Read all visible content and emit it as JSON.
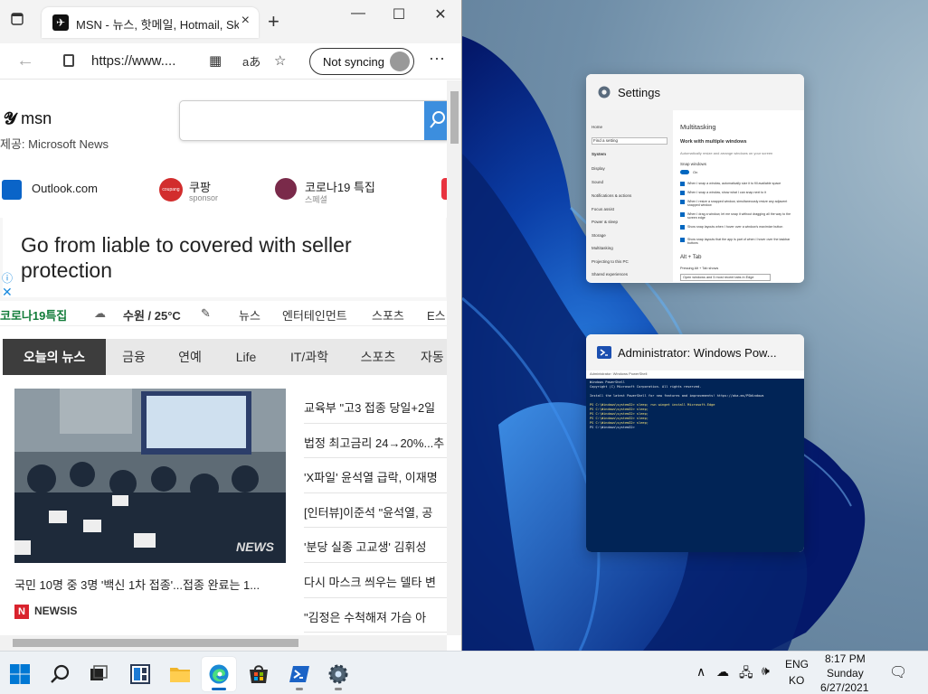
{
  "browser": {
    "tab_title": "MSN - 뉴스, 핫메일, Hotmail, Skype",
    "url": "https://www....",
    "sync_label": "Not syncing",
    "new_tab_symbol": "+",
    "read_aloud_label": "aあ"
  },
  "msn": {
    "logo_text": "msn",
    "provider": "제공: Microsoft News",
    "quick_links": [
      {
        "label": "Outlook.com",
        "sub": ""
      },
      {
        "label": "쿠팡",
        "sub": "sponsor"
      },
      {
        "label": "코로나19 특집",
        "sub": "스페셜"
      }
    ],
    "coupang_icon_text": "coupang",
    "ad_text": "Go from liable to covered with seller protection",
    "ribbon": {
      "covid": "코로나19특집",
      "weather": "수원 / 25°C",
      "links": [
        "뉴스",
        "엔터테인먼트",
        "스포츠",
        "E스"
      ]
    },
    "nav_tabs": [
      "오늘의 뉴스",
      "금융",
      "연예",
      "Life",
      "IT/과학",
      "스포츠",
      "자동"
    ],
    "lead_caption": "국민 10명 중 3명 '백신 1차 접종'...접종 완료는 1...",
    "lead_source": "NEWSIS",
    "lead_source_initial": "N",
    "headlines": [
      "교육부 \"고3 접종 당일+2일",
      "법정 최고금리 24→20%...추",
      "'X파일' 윤석열 급락, 이재명",
      "[인터뷰]이준석 \"윤석열, 공",
      "'분당 실종 고교생' 김휘성",
      "다시 마스크 씌우는 델타 변",
      "\"김정은 수척해져 가슴 아"
    ]
  },
  "snap_settings": {
    "title": "Settings",
    "side_items": [
      "Home",
      "Find a setting",
      "System",
      "Display",
      "Sound",
      "Notifications & actions",
      "Focus assist",
      "Power & sleep",
      "Storage",
      "Multitasking",
      "Projecting to this PC",
      "Shared experiences"
    ],
    "heading": "Multitasking",
    "subheading": "Work with multiple windows",
    "desc": "Automatically resize and arrange windows on your screen",
    "snap_label": "Snap windows",
    "toggle_on": "On",
    "options": [
      "When I snap a window, automatically size it to fill available space",
      "When I snap a window, show what I can snap next to it",
      "When I resize a snapped window, simultaneously resize any adjacent snapped window",
      "When I drag a window, let me snap it without dragging all the way to the screen edge",
      "Show snap layouts when I hover over a window's maximize button",
      "Show snap layouts that the app is part of when I hover over the taskbar buttons"
    ],
    "alt_tab": "Alt + Tab",
    "alt_tab_desc": "Pressing Alt + Tab shows",
    "alt_tab_value": "Open windows and 5 most recent tabs in Edge"
  },
  "snap_powershell": {
    "title": "Administrator: Windows Pow...",
    "titlebar_text": "Administrator: Windows PowerShell",
    "lines": [
      "Windows PowerShell",
      "Copyright (C) Microsoft Corporation. All rights reserved.",
      "",
      "Install the latest PowerShell for new features and improvements! https://aka.ms/PSWindows",
      "",
      "PS C:\\Windows\\system32> sleep; run winget install Microsoft.Edge",
      "PS C:\\Windows\\system32> sleep; ",
      "PS C:\\Windows\\system32> sleep; ",
      "PS C:\\Windows\\system32> sleep; ",
      "PS C:\\Windows\\system32> sleep; ",
      "PS C:\\Windows\\system32> "
    ]
  },
  "taskbar": {
    "lang_top": "ENG",
    "lang_bottom": "KO",
    "time": "8:17 PM",
    "day": "Sunday",
    "date": "6/27/2021"
  },
  "colors": {
    "accent": "#0067c0",
    "ps_bg": "#012456",
    "msn_search": "#3c8ede",
    "nav_active": "#3d3d3d"
  }
}
